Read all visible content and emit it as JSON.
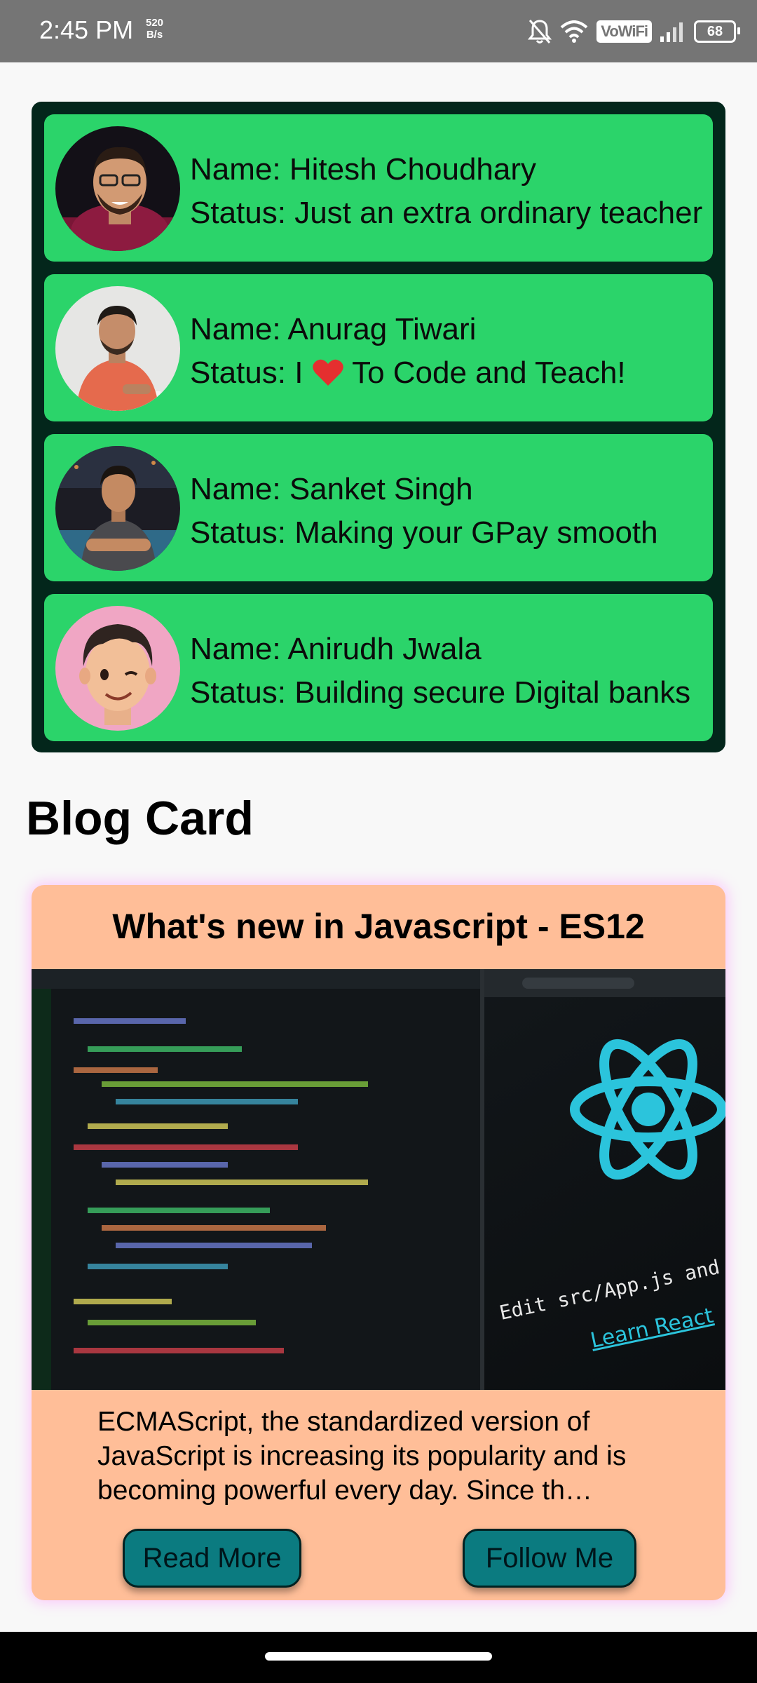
{
  "status_bar": {
    "time": "2:45 PM",
    "net_speed_value": "520",
    "net_speed_unit": "B/s",
    "vowifi": "VoWiFi",
    "battery": "68",
    "icons": [
      "mute-bell-icon",
      "wifi-icon",
      "signal-icon",
      "battery-icon"
    ]
  },
  "contacts": [
    {
      "name": "Name: Hitesh Choudhary",
      "status": "Status: Just an extra ordinary teacher"
    },
    {
      "name": "Name: Anurag Tiwari",
      "status_prefix": "Status: I ",
      "status_suffix": " To Code and Teach!"
    },
    {
      "name": "Name: Sanket Singh",
      "status": "Status: Making your GPay smooth"
    },
    {
      "name": "Name: Anirudh Jwala",
      "status": "Status: Building secure Digital banks"
    }
  ],
  "blog": {
    "heading": "Blog Card",
    "title": "What's new in Javascript - ES12",
    "image_text_edit": "Edit src/App.js and save to relo",
    "image_text_learn": "Learn React",
    "description": "ECMAScript, the standardized version of JavaScript is increasing its popularity and is becoming powerful every day. Since th…",
    "read_more": "Read More",
    "follow_me": "Follow Me"
  },
  "colors": {
    "contacts_bg": "#03261b",
    "contact_card": "#2bd46a",
    "blog_card": "#ffbe98",
    "button": "#0b7b80",
    "react_blue": "#2bc4dc"
  }
}
